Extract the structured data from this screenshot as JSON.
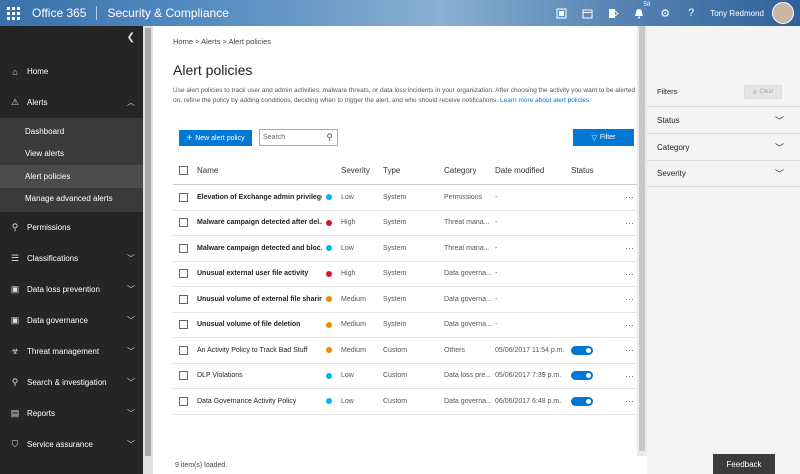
{
  "topbar": {
    "app_name": "Office 365",
    "product_name": "Security & Compliance",
    "notification_count": "58",
    "user_name": "Tony Redmond"
  },
  "sidebar": {
    "items": [
      {
        "label": "Home",
        "icon": "home-icon"
      },
      {
        "label": "Alerts",
        "icon": "alert-icon",
        "expanded": true,
        "sub": [
          {
            "label": "Dashboard"
          },
          {
            "label": "View alerts"
          },
          {
            "label": "Alert policies",
            "active": true
          },
          {
            "label": "Manage advanced alerts"
          }
        ]
      },
      {
        "label": "Permissions",
        "icon": "permissions-icon"
      },
      {
        "label": "Classifications",
        "icon": "classifications-icon"
      },
      {
        "label": "Data loss prevention",
        "icon": "lock-icon"
      },
      {
        "label": "Data governance",
        "icon": "lock-icon"
      },
      {
        "label": "Threat management",
        "icon": "biohazard-icon"
      },
      {
        "label": "Search & investigation",
        "icon": "search-icon"
      },
      {
        "label": "Reports",
        "icon": "chart-icon"
      },
      {
        "label": "Service assurance",
        "icon": "shield-icon"
      }
    ]
  },
  "breadcrumb": {
    "home": "Home",
    "alerts": "Alerts",
    "current": "Alert policies",
    "separator": ">"
  },
  "page": {
    "title": "Alert policies",
    "description": "Use alert policies to track user and admin activities, malware threats, or data loss incidents in your organization. After choosing the activity you want to be alerted on, refine the policy by adding conditions, deciding when to trigger the alert, and who should receive notifications.",
    "learn_more": "Learn more about alert policies"
  },
  "toolbar": {
    "new_label": "New alert policy",
    "search_placeholder": "Search",
    "filter_label": "Filter"
  },
  "table": {
    "columns": {
      "name": "Name",
      "severity": "Severity",
      "type": "Type",
      "category": "Category",
      "date": "Date modified",
      "status": "Status"
    },
    "rows": [
      {
        "name": "Elevation of Exchange admin privilege",
        "severity": "Low",
        "sev_color": "#00b7eb",
        "type": "System",
        "category": "Permissions",
        "date": "-",
        "toggle": false,
        "bold": true
      },
      {
        "name": "Malware campaign detected after del...",
        "severity": "High",
        "sev_color": "#d9142b",
        "type": "System",
        "category": "Threat mana...",
        "date": "-",
        "toggle": false,
        "bold": true
      },
      {
        "name": "Malware campaign detected and bloc...",
        "severity": "Low",
        "sev_color": "#00b7eb",
        "type": "System",
        "category": "Threat mana...",
        "date": "-",
        "toggle": false,
        "bold": true
      },
      {
        "name": "Unusual external user file activity",
        "severity": "High",
        "sev_color": "#d9142b",
        "type": "System",
        "category": "Data governa...",
        "date": "-",
        "toggle": false,
        "bold": true
      },
      {
        "name": "Unusual volume of external file sharin...",
        "severity": "Medium",
        "sev_color": "#f08a00",
        "type": "System",
        "category": "Data governa...",
        "date": "-",
        "toggle": false,
        "bold": true
      },
      {
        "name": "Unusual volume of file deletion",
        "severity": "Medium",
        "sev_color": "#f08a00",
        "type": "System",
        "category": "Data governa...",
        "date": "-",
        "toggle": false,
        "bold": true
      },
      {
        "name": "An Activity Policy to Track Bad Stuff",
        "severity": "Medium",
        "sev_color": "#f08a00",
        "type": "Custom",
        "category": "Others",
        "date": "05/06/2017 11:54 p.m.",
        "toggle": true,
        "bold": false
      },
      {
        "name": "DLP Violations",
        "severity": "Low",
        "sev_color": "#00b7eb",
        "type": "Custom",
        "category": "Data loss pre...",
        "date": "05/06/2017 7:39 p.m.",
        "toggle": true,
        "bold": false
      },
      {
        "name": "Data Governance Activity Policy",
        "severity": "Low",
        "sev_color": "#00b7eb",
        "type": "Custom",
        "category": "Data governa...",
        "date": "06/06/2017 6:48 p.m.",
        "toggle": true,
        "bold": false
      }
    ],
    "more": "···"
  },
  "footer": {
    "count": "9 item(s) loaded."
  },
  "filters": {
    "title": "Filters",
    "clear_label": "Clear",
    "items": [
      "Status",
      "Category",
      "Severity"
    ]
  },
  "feedback_label": "Feedback",
  "colors": {
    "accent": "#0078d4",
    "sidebar_bg": "#252525"
  }
}
